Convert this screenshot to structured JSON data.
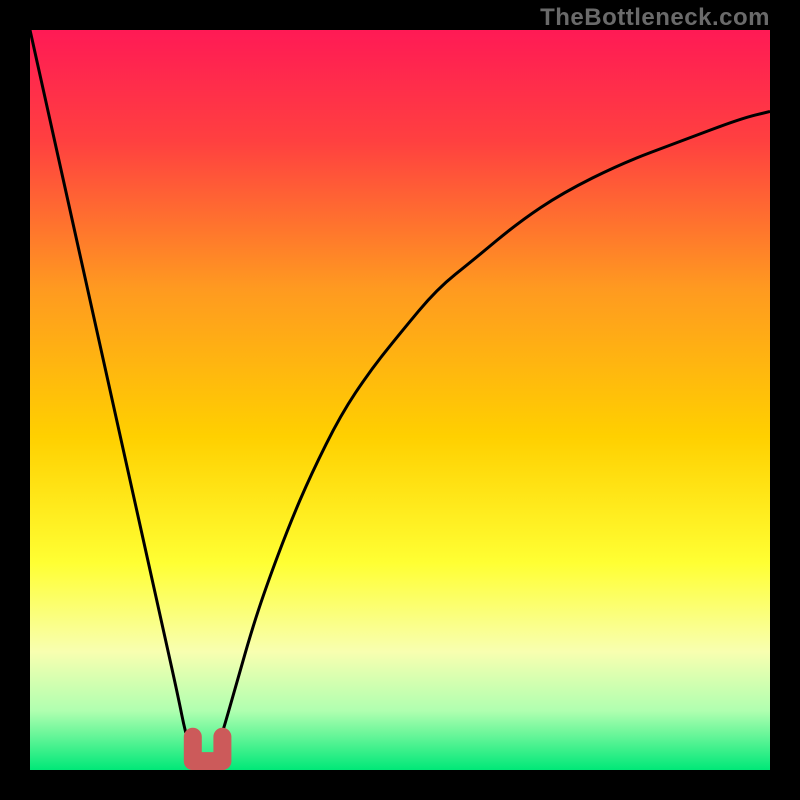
{
  "watermark": "TheBottleneck.com",
  "chart_data": {
    "type": "line",
    "title": "",
    "xlabel": "",
    "ylabel": "",
    "xlim": [
      0,
      100
    ],
    "ylim": [
      0,
      100
    ],
    "grid": false,
    "series": [
      {
        "name": "bottleneck-curve",
        "x": [
          0,
          2,
          4,
          6,
          8,
          10,
          12,
          14,
          16,
          18,
          20,
          21,
          22,
          23,
          24,
          25,
          26,
          28,
          30,
          32,
          35,
          38,
          42,
          46,
          50,
          55,
          60,
          66,
          72,
          80,
          88,
          96,
          100
        ],
        "y": [
          100,
          91,
          82,
          73,
          64,
          55,
          46,
          37,
          28,
          19,
          10,
          5,
          2,
          0,
          0,
          2,
          5,
          12,
          19,
          25,
          33,
          40,
          48,
          54,
          59,
          65,
          69,
          74,
          78,
          82,
          85,
          88,
          89
        ],
        "color": "#000000"
      }
    ],
    "marker": {
      "name": "optimal-range",
      "x_range": [
        22,
        26
      ],
      "y": 1.2,
      "color": "#cc5a5a"
    },
    "background_gradient": {
      "stops": [
        {
          "offset": 0.0,
          "color": "#ff1a55"
        },
        {
          "offset": 0.15,
          "color": "#ff4040"
        },
        {
          "offset": 0.35,
          "color": "#ff9a20"
        },
        {
          "offset": 0.55,
          "color": "#ffd000"
        },
        {
          "offset": 0.72,
          "color": "#ffff33"
        },
        {
          "offset": 0.84,
          "color": "#f8ffb0"
        },
        {
          "offset": 0.92,
          "color": "#b0ffb0"
        },
        {
          "offset": 1.0,
          "color": "#00e878"
        }
      ]
    }
  }
}
